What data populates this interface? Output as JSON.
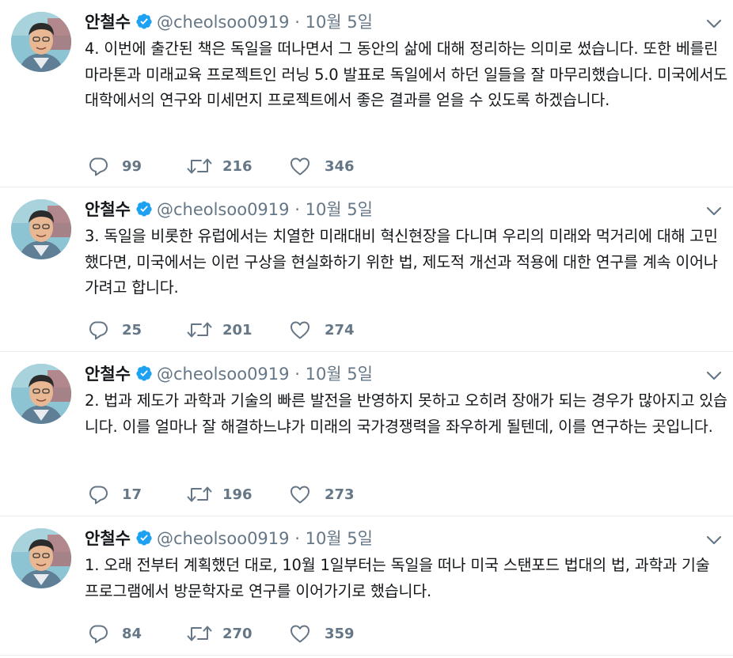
{
  "tweets": [
    {
      "name": "안철수",
      "handle": "@cheolsoo0919",
      "separator": "·",
      "date": "10월 5일",
      "text": "4. 이번에 출간된 책은 독일을 떠나면서 그 동안의 삶에 대해 정리하는 의미로 썼습니다. 또한 베를린 마라톤과 미래교육 프로젝트인 러닝 5.0 발표로 독일에서 하던 일들을 잘 마무리했습니다. 미국에서도 대학에서의 연구와 미세먼지 프로젝트에서 좋은 결과를 얻을 수 있도록 하겠습니다.",
      "replies": "99",
      "retweets": "216",
      "likes": "346"
    },
    {
      "name": "안철수",
      "handle": "@cheolsoo0919",
      "separator": "·",
      "date": "10월 5일",
      "text": "3. 독일을 비롯한 유럽에서는 치열한 미래대비 혁신현장을 다니며 우리의 미래와 먹거리에 대해 고민했다면, 미국에서는 이런 구상을 현실화하기 위한 법, 제도적 개선과 적용에 대한 연구를 계속 이어나가려고 합니다.",
      "replies": "25",
      "retweets": "201",
      "likes": "274"
    },
    {
      "name": "안철수",
      "handle": "@cheolsoo0919",
      "separator": "·",
      "date": "10월 5일",
      "text": "2. 법과 제도가 과학과 기술의 빠른 발전을 반영하지 못하고 오히려 장애가 되는 경우가 많아지고 있습니다. 이를 얼마나 잘 해결하느냐가 미래의 국가경쟁력을 좌우하게 될텐데, 이를 연구하는 곳입니다.",
      "replies": "17",
      "retweets": "196",
      "likes": "273"
    },
    {
      "name": "안철수",
      "handle": "@cheolsoo0919",
      "separator": "·",
      "date": "10월 5일",
      "text": "1. 오래 전부터 계획했던 대로, 10월 1일부터는 독일을 떠나 미국 스탠포드 법대의 법, 과학과 기술 프로그램에서 방문학자로 연구를 이어가기로 했습니다.",
      "replies": "84",
      "retweets": "270",
      "likes": "359"
    }
  ],
  "colors": {
    "text": "#14171a",
    "secondary": "#657786",
    "verified": "#1da1f2",
    "separator": "#e6ecf0"
  },
  "icons": [
    "avatar",
    "verified-badge-icon",
    "chevron-down-icon",
    "reply-icon",
    "retweet-icon",
    "like-icon"
  ]
}
